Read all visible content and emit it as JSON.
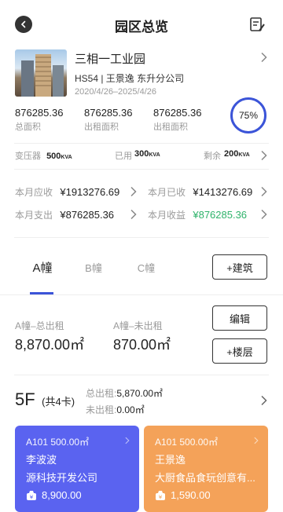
{
  "header": {
    "title": "园区总览"
  },
  "park": {
    "name": "三相一工业园",
    "code_manager": "HS54 | 王景逸 东升分公司",
    "date_range": "2020/4/26–2025/4/26",
    "stats": [
      {
        "value": "876285.36",
        "label": "总面积"
      },
      {
        "value": "876285.36",
        "label": "出租面积"
      },
      {
        "value": "876285.36",
        "label": "出租面积"
      }
    ],
    "occupancy": "75%"
  },
  "power": {
    "transformer_label": "变压器",
    "transformer_value": "500",
    "used_label": "已用",
    "used_value": "300",
    "remaining_label": "剩余",
    "remaining_value": "200",
    "unit": "KVA"
  },
  "finance": {
    "receivable_label": "本月应收",
    "receivable_value": "¥1913276.69",
    "received_label": "本月已收",
    "received_value": "¥1413276.69",
    "expense_label": "本月支出",
    "expense_value": "¥876285.36",
    "income_label": "本月收益",
    "income_value": "¥876285.36"
  },
  "tabs": [
    {
      "label": "A幢",
      "active": true
    },
    {
      "label": "B幢",
      "active": false
    },
    {
      "label": "C幢",
      "active": false
    }
  ],
  "add_building_label": "+建筑",
  "building": {
    "total_label": "A幢–总出租",
    "total_value": "8,870.00㎡",
    "unrented_label": "A幢–未出租",
    "unrented_value": "870.00㎡",
    "edit_label": "编辑",
    "add_floor_label": "+楼层"
  },
  "floor": {
    "title": "5F",
    "subtitle": "(共4卡)",
    "rented_label": "总出租:",
    "rented_value": "5,870.00㎡",
    "unrented_label": "未出租:",
    "unrented_value": "0.00㎡"
  },
  "units": [
    {
      "head": "A101  500.00㎡",
      "person": "李波波",
      "company": "源科技开发公司",
      "price": "8,900.00",
      "color": "#5a63f0"
    },
    {
      "head": "A101  500.00㎡",
      "person": "王景逸",
      "company": "大厨食品食玩创意有...",
      "price": "1,590.00",
      "color": "#f4a259"
    }
  ],
  "colors": {
    "accent": "#3b54d8",
    "income": "#2fb36b"
  }
}
